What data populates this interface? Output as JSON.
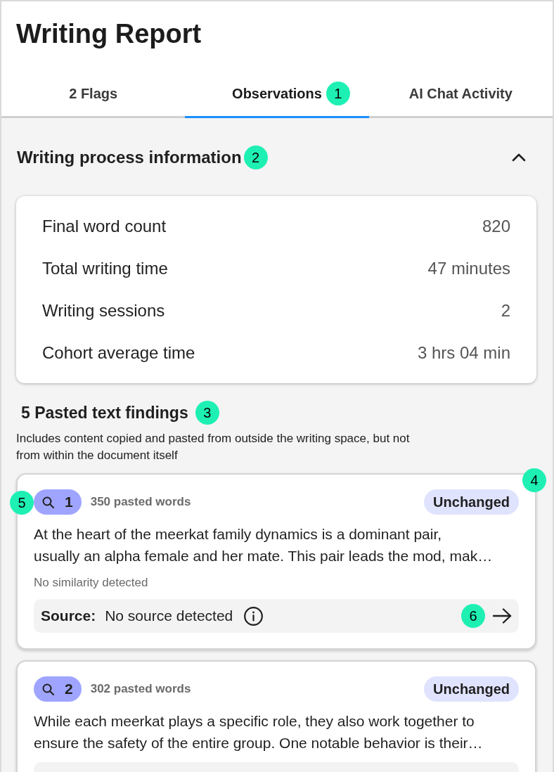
{
  "header": {
    "title": "Writing Report"
  },
  "tabs": [
    {
      "label": "2 Flags",
      "selected": false
    },
    {
      "label": "Observations",
      "selected": true,
      "callout": "1"
    },
    {
      "label": "AI Chat Activity",
      "selected": false
    }
  ],
  "process_section": {
    "title": "Writing process information",
    "callout": "2",
    "expanded": true,
    "stats": [
      {
        "label": "Final word count",
        "value": "820"
      },
      {
        "label": "Total writing time",
        "value": "47 minutes"
      },
      {
        "label": "Writing sessions",
        "value": "2"
      },
      {
        "label": "Cohort average time",
        "value": "3 hrs 04 min"
      }
    ]
  },
  "pasted_section": {
    "title": "5 Pasted text findings",
    "callout": "3",
    "description": "Includes content copied and pasted from outside the writing space, but not from within the document itself",
    "findings": [
      {
        "number": "1",
        "card_callout": "4",
        "number_callout": "5",
        "pasted_words": "350 pasted words",
        "status": "Unchanged",
        "text_lines": [
          "At the heart of the meerkat family dynamics is a dominant pair,",
          "usually an alpha female and her mate. This pair leads the mod, mak…"
        ],
        "similarity": "No similarity detected",
        "source": {
          "label": "Source:",
          "value": "No source detected",
          "callout": "6"
        }
      },
      {
        "number": "2",
        "pasted_words": "302 pasted words",
        "status": "Unchanged",
        "text_lines": [
          "While each meerkat plays a specific role, they also work together to",
          "ensure the safety of the entire group. One notable behavior is their…"
        ]
      }
    ]
  }
}
